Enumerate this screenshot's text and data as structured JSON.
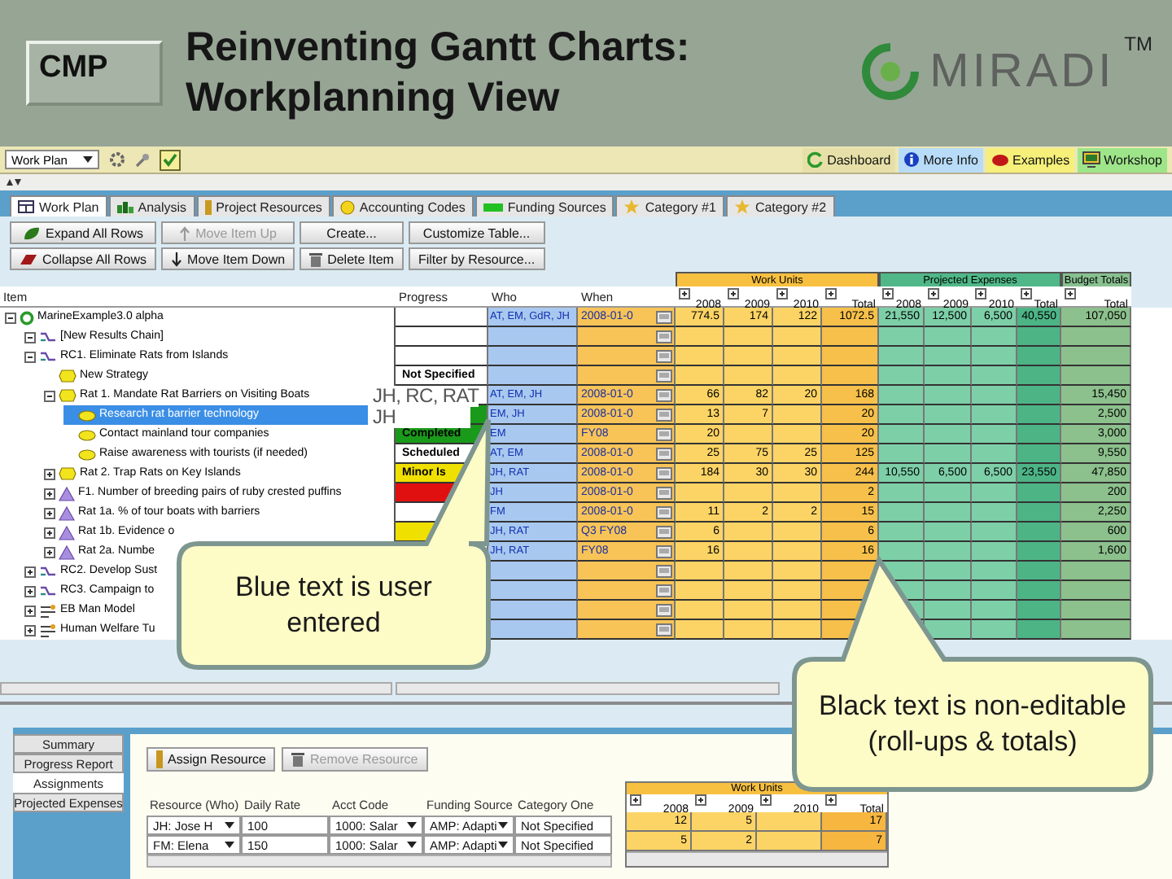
{
  "slide": {
    "logo": "CMP",
    "title_lines": [
      "Reinventing Gantt Charts:",
      "Workplanning View"
    ],
    "brand": "MIRADI",
    "trademark": "TM"
  },
  "toolbar": {
    "view": "Work Plan",
    "links": [
      {
        "label": "Dashboard",
        "kind": "dashboard",
        "color": "#e6e0a8"
      },
      {
        "label": "More Info",
        "kind": "info",
        "color": "#b8dcf8"
      },
      {
        "label": "Examples",
        "kind": "examples",
        "color": "#f6f07a"
      },
      {
        "label": "Workshop",
        "kind": "workshop",
        "color": "#9ee58a"
      }
    ]
  },
  "tabs": [
    {
      "label": "Work Plan",
      "kind": "table",
      "selected": true
    },
    {
      "label": "Analysis",
      "kind": "analysis",
      "selected": false
    },
    {
      "label": "Project Resources",
      "kind": "resources",
      "selected": false
    },
    {
      "label": "Accounting Codes",
      "kind": "accounting",
      "selected": false
    },
    {
      "label": "Funding Sources",
      "kind": "funding",
      "selected": false
    },
    {
      "label": "Category #1",
      "kind": "category",
      "selected": false
    },
    {
      "label": "Category #2",
      "kind": "category",
      "selected": false
    }
  ],
  "buttons": [
    {
      "label": "Expand All Rows",
      "kind": "expand",
      "disabled": false
    },
    {
      "label": "Move Item Up",
      "kind": "up",
      "disabled": true
    },
    {
      "label": "Create...",
      "kind": "plain",
      "disabled": false
    },
    {
      "label": "Customize Table...",
      "kind": "plain",
      "disabled": false
    },
    {
      "label": "Collapse All Rows",
      "kind": "collapse",
      "disabled": false
    },
    {
      "label": "Move Item Down",
      "kind": "down",
      "disabled": false
    },
    {
      "label": "Delete Item",
      "kind": "delete",
      "disabled": false
    },
    {
      "label": "Filter by Resource...",
      "kind": "plain",
      "disabled": false
    }
  ],
  "table": {
    "columns": [
      "Item",
      "Progress",
      "Who",
      "When"
    ],
    "groups": [
      {
        "label": "Work Units",
        "years": [
          "2008",
          "2009",
          "2010",
          "Total"
        ]
      },
      {
        "label": "Projected Expenses",
        "years": [
          "2008",
          "2009",
          "2010",
          "Total"
        ]
      },
      {
        "label": "Budget Totals",
        "years": [
          "Total"
        ]
      }
    ],
    "rows": [
      {
        "label": "MarineExample3.0 alpha",
        "kind": "project",
        "expanded": true,
        "selected": false,
        "progress": {
          "color": "#ffffff"
        },
        "who": "AT, EM, GdR, JH",
        "when": "2008-01-0",
        "work_units": {
          "c2008": "774.5",
          "c2009": "174",
          "c2010": "122",
          "total": "1072.5"
        },
        "expenses": {
          "c2008": "21,550",
          "c2009": "12,500",
          "c2010": "6,500",
          "total": "40,550"
        },
        "budget_total": "107,050",
        "children": [
          {
            "label": "[New Results Chain]",
            "kind": "results_chain",
            "expanded": true,
            "selected": false,
            "progress": {
              "color": "#ffffff"
            }
          },
          {
            "label": "RC1. Eliminate Rats from Islands",
            "kind": "results_chain",
            "expanded": true,
            "selected": false,
            "progress": {
              "color": "#ffffff"
            },
            "children": [
              {
                "label": "New Strategy",
                "kind": "strategy",
                "selected": false,
                "progress": {
                  "label": "Not Specified",
                  "color": "#ffffff"
                }
              },
              {
                "label": "Rat 1. Mandate Rat Barriers on Visiting Boats",
                "kind": "strategy",
                "expanded": true,
                "selected": false,
                "who": "AT, EM, JH",
                "when": "2008-01-0",
                "work_units": {
                  "c2008": "66",
                  "c2009": "82",
                  "c2010": "20",
                  "total": "168"
                },
                "budget_total": "15,450",
                "children": [
                  {
                    "label": "Research rat barrier technology",
                    "kind": "activity",
                    "selected": true,
                    "progress": {
                      "color": "#1a9a1a"
                    },
                    "who": "EM, JH",
                    "when": "2008-01-0",
                    "work_units": {
                      "c2008": "13",
                      "c2009": "7",
                      "total": "20"
                    },
                    "budget_total": "2,500"
                  },
                  {
                    "label": "Contact mainland tour companies",
                    "kind": "activity",
                    "selected": false,
                    "progress": {
                      "label": "Completed",
                      "color": "#1a9a1a"
                    },
                    "who": "EM",
                    "when": "FY08",
                    "work_units": {
                      "c2008": "20",
                      "total": "20"
                    },
                    "budget_total": "3,000"
                  },
                  {
                    "label": "Raise awareness with tourists (if needed)",
                    "kind": "activity",
                    "selected": false,
                    "progress": {
                      "label": "Scheduled",
                      "color": "#ffffff"
                    },
                    "who": "AT, EM",
                    "when": "2008-01-0",
                    "work_units": {
                      "c2008": "25",
                      "c2009": "75",
                      "c2010": "25",
                      "total": "125"
                    },
                    "budget_total": "9,550"
                  }
                ]
              },
              {
                "label": "Rat 2. Trap Rats on Key Islands",
                "kind": "strategy",
                "expanded": false,
                "selected": false,
                "progress": {
                  "label": "Minor Is",
                  "color": "#f0e000"
                },
                "who": "JH, RAT",
                "when": "2008-01-0",
                "work_units": {
                  "c2008": "184",
                  "c2009": "30",
                  "c2010": "30",
                  "total": "244"
                },
                "expenses": {
                  "c2008": "10,550",
                  "c2009": "6,500",
                  "c2010": "6,500",
                  "total": "23,550"
                },
                "budget_total": "47,850"
              },
              {
                "label": "F1. Number of breeding pairs of ruby crested puffins",
                "kind": "indicator",
                "expanded": false,
                "selected": false,
                "progress": {
                  "color": "#e01010"
                },
                "who": "JH",
                "when": "2008-01-0",
                "work_units": {
                  "total": "2"
                },
                "budget_total": "200"
              },
              {
                "label": "Rat 1a. % of tour boats with barriers",
                "kind": "indicator",
                "expanded": false,
                "selected": false,
                "progress": {
                  "color": "#ffffff"
                },
                "who": "FM",
                "when": "2008-01-0",
                "work_units": {
                  "c2008": "11",
                  "c2009": "2",
                  "c2010": "2",
                  "total": "15"
                },
                "budget_total": "2,250"
              },
              {
                "label": "Rat 1b. Evidence o",
                "kind": "indicator",
                "expanded": false,
                "selected": false,
                "progress": {
                  "color": "#f0e000"
                },
                "who": "JH, RAT",
                "when": "Q3 FY08",
                "work_units": {
                  "c2008": "6",
                  "total": "6"
                },
                "budget_total": "600"
              },
              {
                "label": "Rat 2a. Numbe",
                "kind": "indicator",
                "expanded": false,
                "selected": false,
                "who": "JH, RAT",
                "when": "FY08",
                "work_units": {
                  "c2008": "16",
                  "total": "16"
                },
                "budget_total": "1,600"
              }
            ]
          },
          {
            "label": "RC2. Develop Sust",
            "kind": "results_chain",
            "expanded": false,
            "selected": false
          },
          {
            "label": "RC3. Campaign to",
            "kind": "results_chain",
            "expanded": false,
            "selected": false
          },
          {
            "label": "EB Man Model",
            "kind": "model",
            "expanded": false,
            "selected": false
          },
          {
            "label": "Human Welfare Tu",
            "kind": "model",
            "expanded": false,
            "selected": false
          }
        ]
      }
    ]
  },
  "overlay_labels": [
    "JH, RC, RAT",
    "JH"
  ],
  "bottom": {
    "side_tabs": [
      {
        "label": "Summary",
        "selected": false
      },
      {
        "label": "Progress Report",
        "selected": false
      },
      {
        "label": "Assignments",
        "selected": true
      },
      {
        "label": "Projected Expenses",
        "selected": false
      }
    ],
    "buttons": [
      {
        "label": "Assign Resource",
        "kind": "assign",
        "disabled": false
      },
      {
        "label": "Remove Resource",
        "kind": "delete",
        "disabled": true
      }
    ],
    "columns": [
      "Resource (Who)",
      "Daily Rate",
      "Acct Code",
      "Funding Source",
      "Category One"
    ],
    "rows": [
      {
        "who": "JH: Jose H",
        "rate": "100",
        "acct": "1000: Salar",
        "funding": "AMP: Adapti",
        "category": "Not Specified"
      },
      {
        "who": "FM: Elena",
        "rate": "150",
        "acct": "1000: Salar",
        "funding": "AMP: Adapti",
        "category": "Not Specified"
      }
    ],
    "work_units": {
      "title": "Work Units",
      "years": [
        "2008",
        "2009",
        "2010",
        "Total"
      ],
      "rows": [
        {
          "c2008": "12",
          "c2009": "5",
          "total": "17"
        },
        {
          "c2008": "5",
          "c2009": "2",
          "total": "7"
        }
      ]
    }
  },
  "callouts": [
    {
      "text": "Blue text is user entered"
    },
    {
      "text": "Black text is non-editable (roll-ups & totals)"
    }
  ]
}
